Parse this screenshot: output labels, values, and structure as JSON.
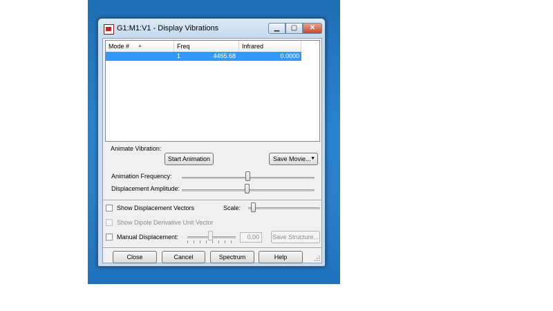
{
  "window": {
    "title": "G1:M1:V1 - Display Vibrations",
    "minimize": "▁",
    "maximize": "▢",
    "close": "✕"
  },
  "list": {
    "headers": [
      "Mode #",
      "Freq",
      "Infrared"
    ],
    "sort_indicator": "▲",
    "rows": [
      {
        "mode": "1",
        "freq": "4465.68",
        "infrared": "0.0000"
      }
    ]
  },
  "animate": {
    "section_label": "Animate Vibration:",
    "start_button": "Start Animation",
    "save_movie_button": "Save Movie...",
    "save_movie_arrow": "▼",
    "frequency_label": "Animation Frequency:",
    "amplitude_label": "Displacement Amplitude:"
  },
  "options": {
    "show_displacement_vectors": "Show Displacement Vectors",
    "scale_label": "Scale:",
    "show_dipole": "Show Dipole Derivative Unit Vector",
    "manual_displacement": "Manual Displacement:",
    "manual_value": "0.00",
    "save_structure_button": "Save Structure..."
  },
  "buttons": {
    "close": "Close",
    "cancel": "Cancel",
    "spectrum": "Spectrum",
    "help": "Help"
  },
  "colors": {
    "selection": "#3399ff",
    "desktop": "#2a7cc6"
  }
}
